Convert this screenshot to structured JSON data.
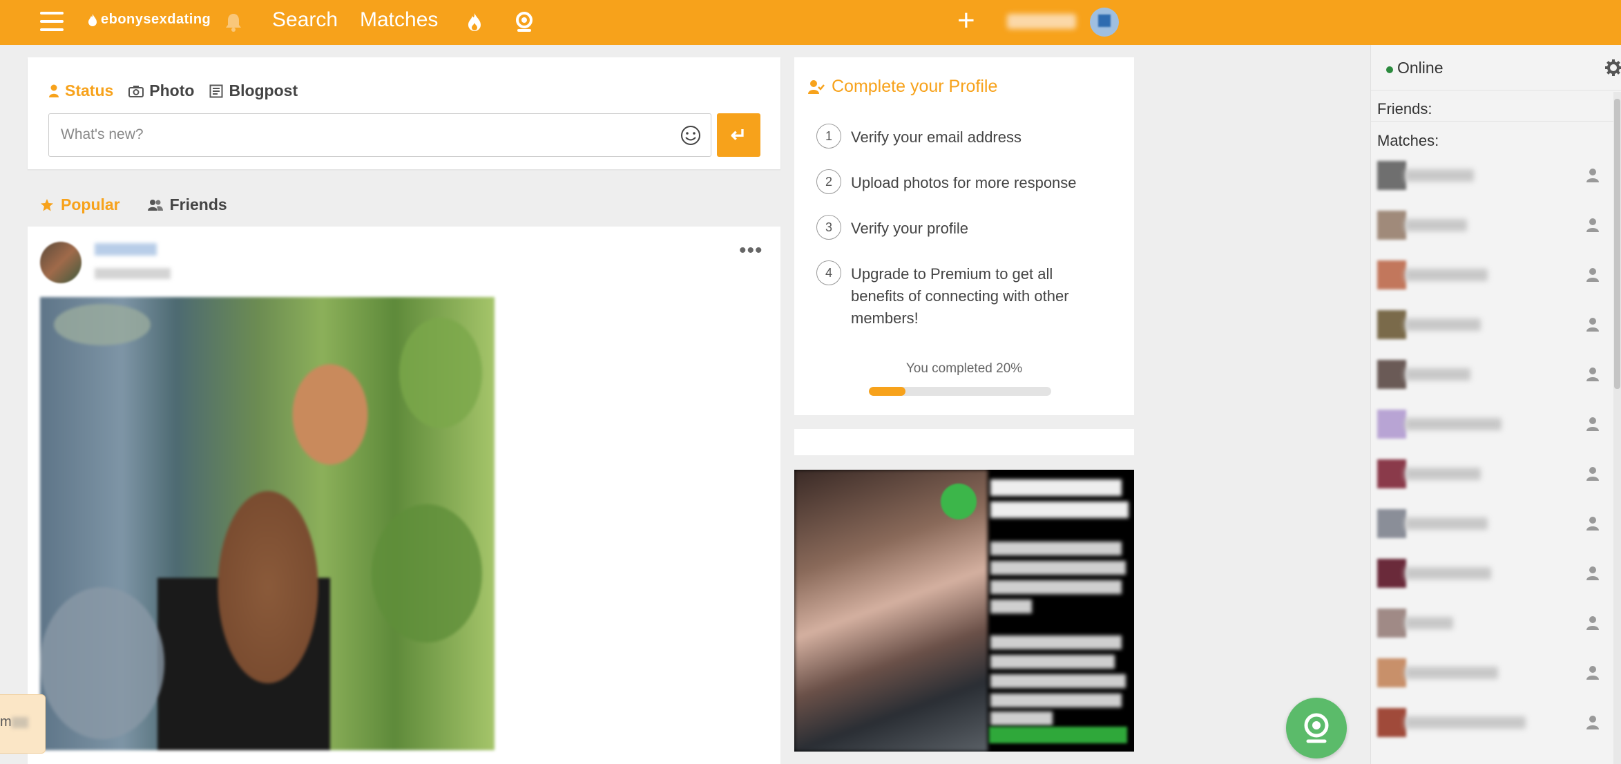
{
  "header": {
    "logo_text": "ebonysexdating",
    "nav": {
      "search": "Search",
      "matches": "Matches"
    },
    "plus": "+",
    "accent_color": "#f7a21b"
  },
  "composer": {
    "tabs": [
      {
        "label": "Status",
        "icon": "person-icon"
      },
      {
        "label": "Photo",
        "icon": "camera-icon"
      },
      {
        "label": "Blogpost",
        "icon": "blog-icon"
      }
    ],
    "placeholder": "What's new?",
    "send_symbol": "↵"
  },
  "feed": {
    "tabs": [
      {
        "label": "Popular",
        "icon": "star-icon"
      },
      {
        "label": "Friends",
        "icon": "friends-icon"
      }
    ],
    "post_menu": "•••"
  },
  "profile": {
    "title": "Complete your Profile",
    "steps": [
      {
        "num": "1",
        "text": "Verify your email address"
      },
      {
        "num": "2",
        "text": "Upload photos for more response"
      },
      {
        "num": "3",
        "text": "Verify your profile"
      },
      {
        "num": "4",
        "text": "Upgrade to Premium to get all benefits of connecting with other members!"
      }
    ],
    "progress_label": "You completed 20%",
    "progress_value": 0.2
  },
  "sidebar": {
    "online": "Online",
    "friends_label": "Friends:",
    "matches_label": "Matches:",
    "online_color": "#2b8a3e"
  }
}
